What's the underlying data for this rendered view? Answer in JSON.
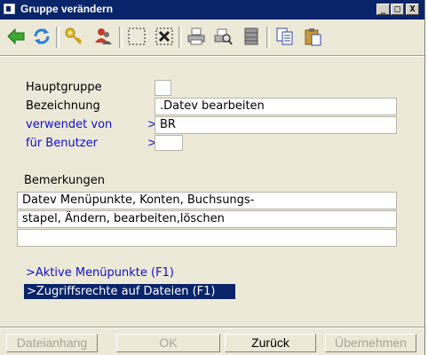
{
  "window": {
    "title": "Gruppe verändern"
  },
  "titlebar_buttons": {
    "minimize": "_",
    "maximize": "□",
    "close": "X"
  },
  "toolbar": {
    "icons": [
      "back-arrow-icon",
      "refresh-icon",
      "key-icon",
      "users-icon",
      "select-frame-icon",
      "delete-frame-icon",
      "printer-icon",
      "print-preview-icon",
      "stack-icon",
      "copy-icon",
      "paste-icon"
    ]
  },
  "form": {
    "hauptgruppe_label": "Hauptgruppe",
    "hauptgruppe_value": "",
    "bezeichnung_label": "Bezeichnung",
    "bezeichnung_value": ".Datev bearbeiten",
    "verwendet_label": "verwendet von",
    "verwendet_arrow": ">",
    "verwendet_value": "BR",
    "benutzer_label": "für Benutzer",
    "benutzer_arrow": ">",
    "benutzer_value": "",
    "bemerkungen_label": "Bemerkungen",
    "bemerkungen_lines": [
      "Datev Menüpunkte, Konten, Buchsungs-",
      "stapel, Ändern, bearbeiten,löschen",
      ""
    ]
  },
  "links": {
    "aktive": ">Aktive Menüpunkte (F1)",
    "zugriff": ">Zugriffsrechte auf Dateien (F1)"
  },
  "buttons": {
    "dateianhang": "Dateianhang",
    "ok": "OK",
    "zurueck": "Zurück",
    "uebernehmen": "Übernehmen"
  }
}
